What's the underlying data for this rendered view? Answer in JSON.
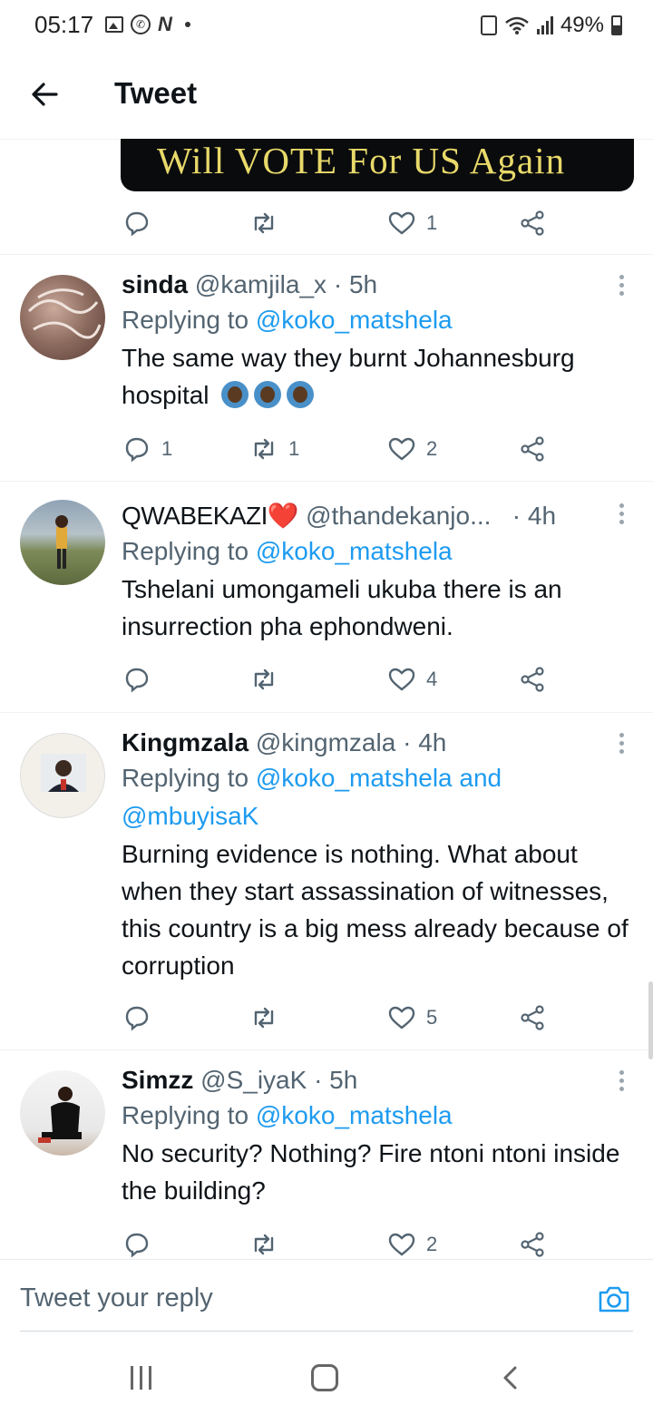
{
  "status_bar": {
    "time": "05:17",
    "battery": "49%",
    "icons": [
      "gallery-icon",
      "whatsapp-icon",
      "n-notification-icon",
      "lock-icon",
      "wifi-icon",
      "signal-icon",
      "battery-icon"
    ]
  },
  "header": {
    "title": "Tweet",
    "back_icon": "back-arrow-icon"
  },
  "embed": {
    "image_text": "Will VOTE For US Again"
  },
  "top_actions": {
    "reply_count": "",
    "retweet_count": "",
    "like_count": "1"
  },
  "tweets": [
    {
      "name": "sinda",
      "handle": "@kamjila_x",
      "time": "5h",
      "replying_prefix": "Replying to ",
      "replying_to": "@koko_matshela",
      "text": "The same way they burnt Johannesburg hospital",
      "emoji_count": 3,
      "reply_count": "1",
      "retweet_count": "1",
      "like_count": "2"
    },
    {
      "name": "QWABEKAZI❤️",
      "handle": "@thandekanjo...",
      "time": "4h",
      "replying_prefix": "Replying to ",
      "replying_to": "@koko_matshela",
      "text": "Tshelani umongameli ukuba there is an insurrection pha ephondweni.",
      "reply_count": "",
      "retweet_count": "",
      "like_count": "4"
    },
    {
      "name": "Kingmzala",
      "handle": "@kingmzala",
      "time": "4h",
      "replying_prefix": "Replying to ",
      "replying_to": "@koko_matshela and @mbuyisaK",
      "text": "Burning evidence is nothing. What about when they start assassination of witnesses, this country is a big mess already because of corruption",
      "reply_count": "",
      "retweet_count": "",
      "like_count": "5"
    },
    {
      "name": "Simzz",
      "handle": "@S_iyaK",
      "time": "5h",
      "replying_prefix": "Replying to ",
      "replying_to": "@koko_matshela",
      "text": "No security? Nothing? Fire ntoni ntoni inside the building?",
      "reply_count": "",
      "retweet_count": "",
      "like_count": "2"
    }
  ],
  "reply_bar": {
    "placeholder": "Tweet your reply",
    "camera_icon": "camera-icon"
  },
  "nav_bar": {
    "icons": [
      "recent-apps-icon",
      "home-icon",
      "back-icon"
    ]
  }
}
